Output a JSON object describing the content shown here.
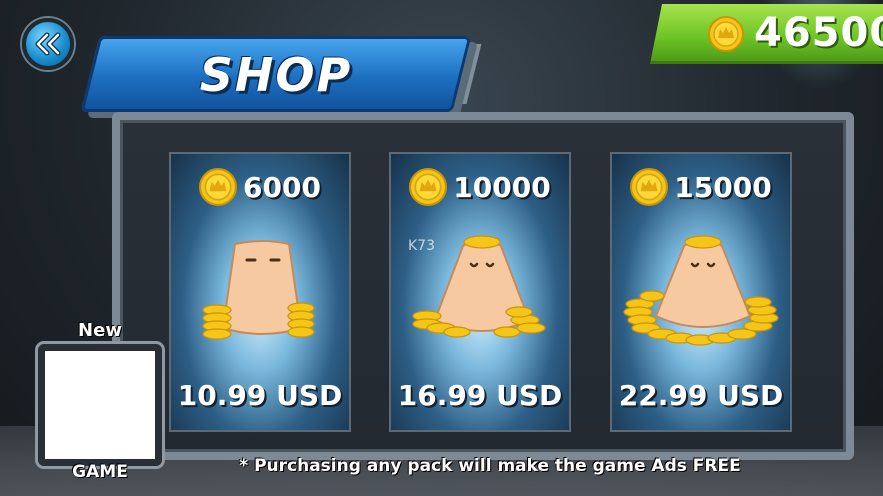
{
  "header": {
    "title": "SHOP",
    "coin_total": "46500",
    "back_icon": "double-chevron-left-icon"
  },
  "packs": [
    {
      "coins": "6000",
      "price": "10.99 USD",
      "icon": "coin-sack-small"
    },
    {
      "coins": "10000",
      "price": "16.99 USD",
      "icon": "coin-sack-medium"
    },
    {
      "coins": "15000",
      "price": "22.99 USD",
      "icon": "coin-sack-large"
    }
  ],
  "promo": {
    "new_label": "New",
    "game_label": "GAME"
  },
  "footer": {
    "note": "* Purchasing any pack will make the game Ads FREE"
  },
  "watermark": "K73",
  "colors": {
    "coin_bar": "#6cc424",
    "title_banner": "#1c6fc0",
    "coin_gold": "#f5c518",
    "back_button": "#1a8fd0"
  }
}
